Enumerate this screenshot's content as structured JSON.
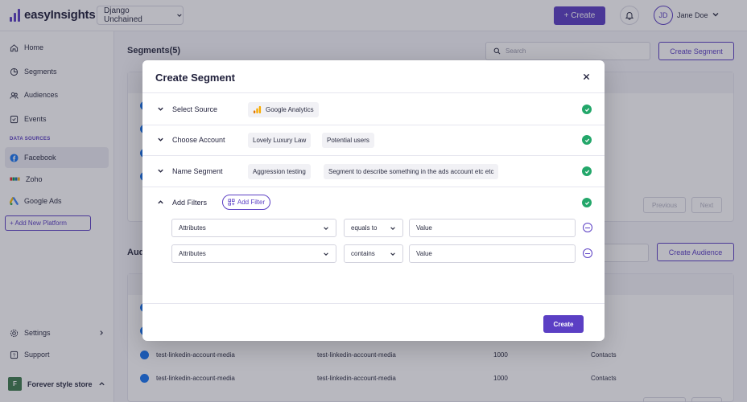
{
  "app": {
    "brand": "easyInsights",
    "workspace": "Django Unchained"
  },
  "topbar": {
    "create_label": "+ Create",
    "user_initials": "JD",
    "user_name": "Jane Doe"
  },
  "sidebar": {
    "items": [
      {
        "label": "Home",
        "icon": "home-icon"
      },
      {
        "label": "Segments",
        "icon": "segments-icon"
      },
      {
        "label": "Audiences",
        "icon": "audiences-icon"
      },
      {
        "label": "Events",
        "icon": "events-icon"
      }
    ],
    "data_sources_label": "DATA SOURCES",
    "sources": [
      {
        "label": "Facebook",
        "icon": "facebook-icon",
        "active": true
      },
      {
        "label": "Zoho",
        "icon": "zoho-icon"
      },
      {
        "label": "Google Ads",
        "icon": "google-ads-icon"
      }
    ],
    "add_platform_label": "+ Add New Platform",
    "settings_label": "Settings",
    "support_label": "Support",
    "store_initial": "F",
    "store_name": "Forever style store"
  },
  "segments": {
    "title": "Segments(5)",
    "search_placeholder": "Search",
    "create_label": "Create Segment",
    "previous_label": "Previous",
    "next_label": "Next"
  },
  "audiences": {
    "title_partial": "Aud",
    "create_label": "Create Audience",
    "rows": [
      {
        "name": "test-linkedin-account-media",
        "segment": "test-linkedin-account-media",
        "size": "1000",
        "type": "Contacts"
      },
      {
        "name": "test-linkedin-account-media",
        "segment": "test-linkedin-account-media",
        "size": "1000",
        "type": "Contacts"
      }
    ]
  },
  "modal": {
    "title": "Create Segment",
    "steps": {
      "source": {
        "label": "Select Source",
        "value": "Google Analytics"
      },
      "account": {
        "label": "Choose Account",
        "account": "Lovely Luxury Law",
        "audience": "Potential users"
      },
      "name": {
        "label": "Name Segment",
        "name": "Aggression testing",
        "description": "Segment to describe something in the ads account etc etc"
      },
      "filters": {
        "label": "Add Filters",
        "add_label": "Add Filter"
      }
    },
    "filters": [
      {
        "attribute": "Attributes",
        "operator": "equals to",
        "value": "Value"
      },
      {
        "attribute": "Attributes",
        "operator": "contains",
        "value": "Value"
      }
    ],
    "submit_label": "Create"
  },
  "colors": {
    "accent": "#5b3fc4",
    "success": "#23a76a",
    "facebook": "#1877f2"
  }
}
